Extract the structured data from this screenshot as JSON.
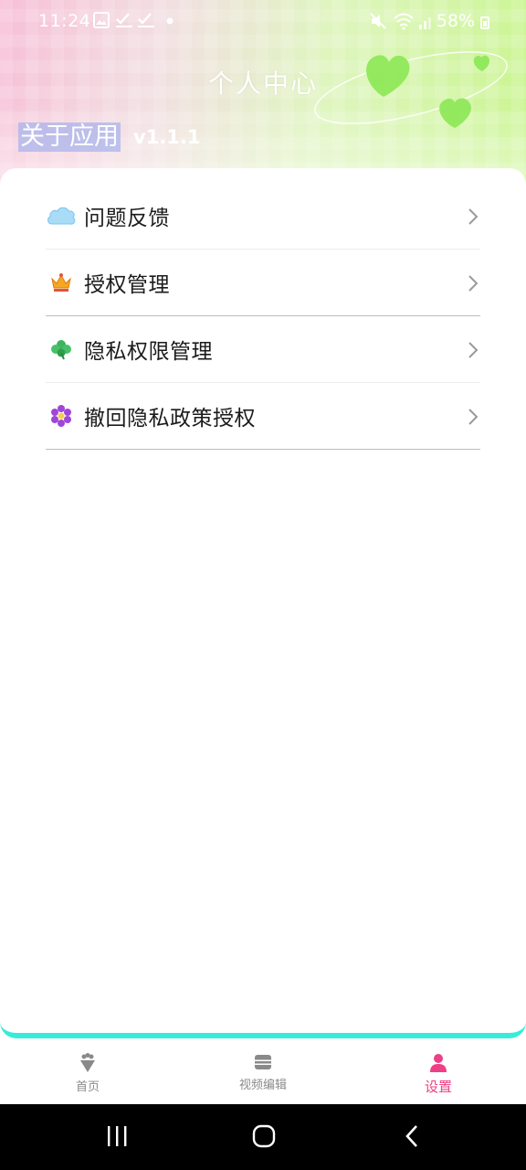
{
  "status_bar": {
    "time": "11:24",
    "battery": "58%"
  },
  "header": {
    "title": "个人中心",
    "about_label": "关于应用",
    "version": "v1.1.1"
  },
  "menu": {
    "items": [
      {
        "label": "问题反馈",
        "icon": "cloud-icon"
      },
      {
        "label": "授权管理",
        "icon": "crown-icon"
      },
      {
        "label": "隐私权限管理",
        "icon": "clover-icon"
      },
      {
        "label": "撤回隐私政策授权",
        "icon": "flower-icon"
      }
    ]
  },
  "tab_bar": {
    "tabs": [
      {
        "label": "首页",
        "icon": "home-icon"
      },
      {
        "label": "视频编辑",
        "icon": "film-icon"
      },
      {
        "label": "设置",
        "icon": "user-icon",
        "active": true
      }
    ]
  },
  "colors": {
    "accent": "#ef3f86",
    "card_border": "#37ecd9",
    "header_pink": "#f7bfd6",
    "header_green": "#c9f58f"
  }
}
